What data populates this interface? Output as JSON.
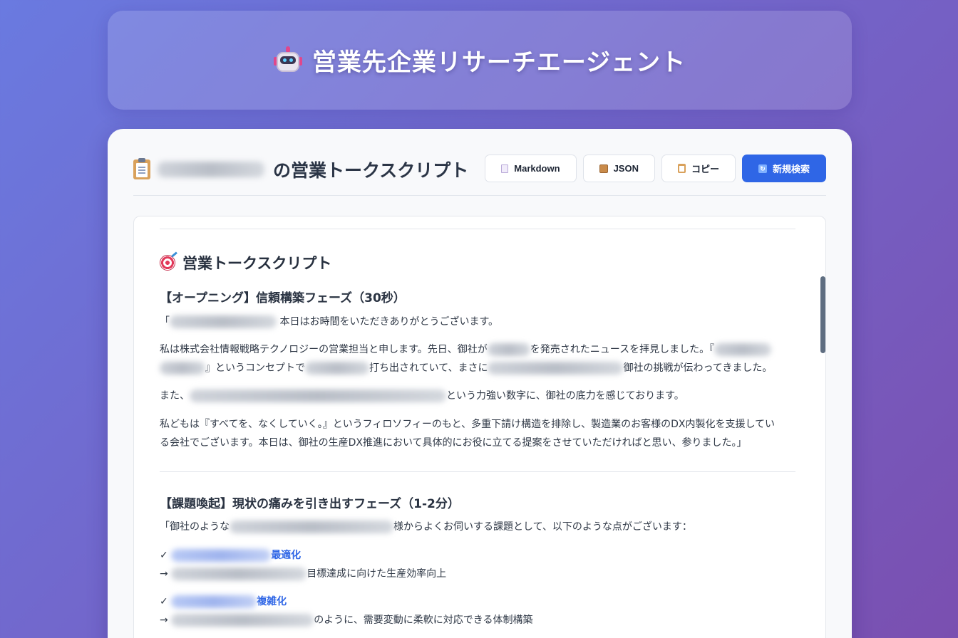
{
  "header": {
    "title": "営業先企業リサーチエージェント",
    "icon": "robot-icon"
  },
  "document": {
    "title_suffix": "の営業トークスクリプト",
    "icon": "clipboard-icon"
  },
  "toolbar": {
    "markdown_label": "Markdown",
    "json_label": "JSON",
    "copy_label": "コピー",
    "new_search_label": "新規検索",
    "primary_color": "#2f66e6"
  },
  "script": {
    "section_title": "営業トークスクリプト",
    "opening": {
      "title": "【オープニング】信頼構築フェーズ（30秒）",
      "p1_open": "「",
      "p1_rest": "本日はお時間をいただきありがとうございます。",
      "p2_a": "私は株式会社情報戦略テクノロジーの営業担当と申します。先日、御社が",
      "p2_b": "を発売されたニュースを拝見しました。『",
      "p2_c": "』というコンセプトで",
      "p2_d": "打ち出されていて、まさに",
      "p2_e": "御社の挑戦が伝わってきました。",
      "p3_a": "また、",
      "p3_b": "という力強い数字に、御社の底力を感じております。",
      "p4_line1": "私どもは『すべてを、なくしていく。』というフィロソフィーのもと、多重下請け構造を排除し、製造業のお客様のDX内製化を支援してい",
      "p4_line2": "る会社でございます。本日は、御社の生産DX推進において具体的にお役に立てる提案をさせていただければと思い、参りました。」"
    },
    "issues": {
      "title": "【課題喚起】現状の痛みを引き出すフェーズ（1-2分）",
      "intro_a": "「御社のような",
      "intro_b": "様からよくお伺いする課題として、以下のような点がございます：",
      "check": "✓",
      "arrow": "→",
      "item1_label": "最適化",
      "item1_detail": "目標達成に向けた生産効率向上",
      "item2_label": "複雑化",
      "item2_detail": "のように、需要変動に柔軟に対応できる体制構築"
    }
  }
}
